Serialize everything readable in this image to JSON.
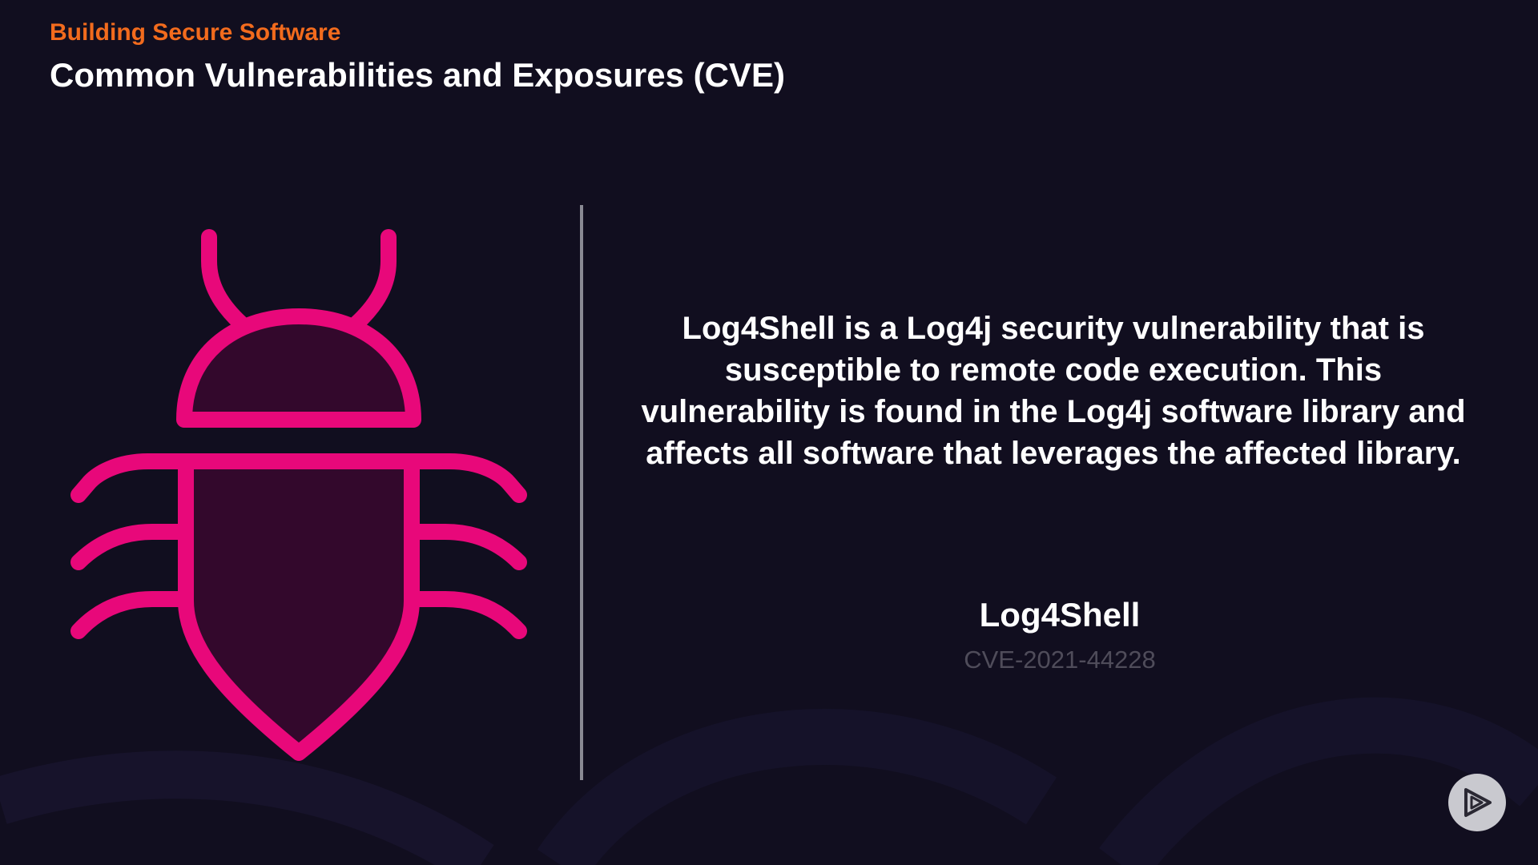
{
  "header": {
    "course_title": "Building Secure Software",
    "slide_title": "Common Vulnerabilities and Exposures (CVE)"
  },
  "main": {
    "description": "Log4Shell is a Log4j security vulnerability that is susceptible to remote code execution. This vulnerability is found in the Log4j software library and affects all software that leverages the affected library.",
    "cve_name": "Log4Shell",
    "cve_id": "CVE-2021-44228"
  },
  "icons": {
    "illustration": "bug-icon",
    "brand": "play-logo-icon"
  },
  "colors": {
    "background": "#110e1f",
    "accent_orange": "#f26b1d",
    "bug_pink": "#e8087a",
    "bug_fill": "#33082c"
  }
}
